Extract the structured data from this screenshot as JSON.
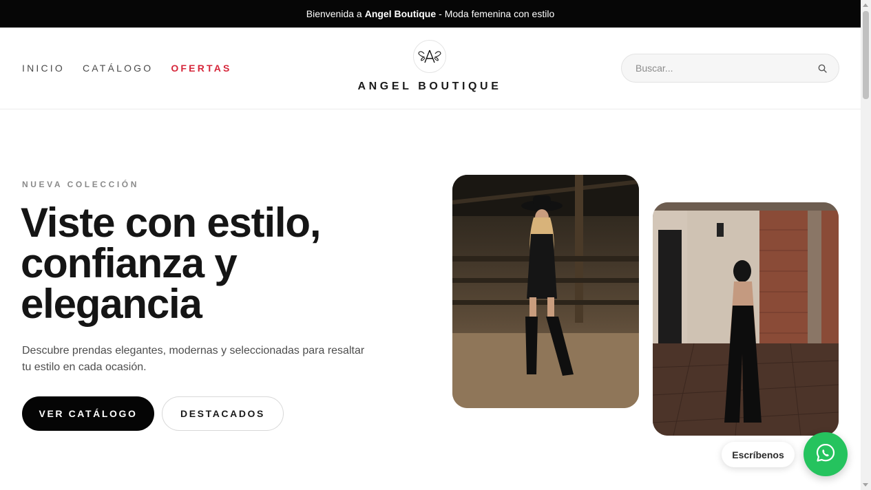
{
  "announcement": {
    "prefix": "Bienvenida a",
    "brand": "Angel Boutique",
    "suffix": "- Moda femenina con estilo"
  },
  "nav": {
    "items": [
      {
        "label": "INICIO"
      },
      {
        "label": "CATÁLOGO"
      },
      {
        "label": "OFERTAS"
      }
    ]
  },
  "logo": {
    "text": "ANGEL BOUTIQUE"
  },
  "search": {
    "placeholder": "Buscar..."
  },
  "hero": {
    "kicker": "NUEVA COLECCIÓN",
    "headline": "Viste con estilo, confianza y elegancia",
    "subtext": "Descubre prendas elegantes, modernas y seleccionadas para resaltar tu estilo en cada ocasión.",
    "primary_button": "VER CATÁLOGO",
    "secondary_button": "DESTACADOS"
  },
  "chat": {
    "label": "Escríbenos",
    "icon": "whatsapp-icon"
  },
  "colors": {
    "accent_sale": "#d6263a",
    "whatsapp_green": "#25c35e",
    "announcement_bg": "#060606"
  }
}
